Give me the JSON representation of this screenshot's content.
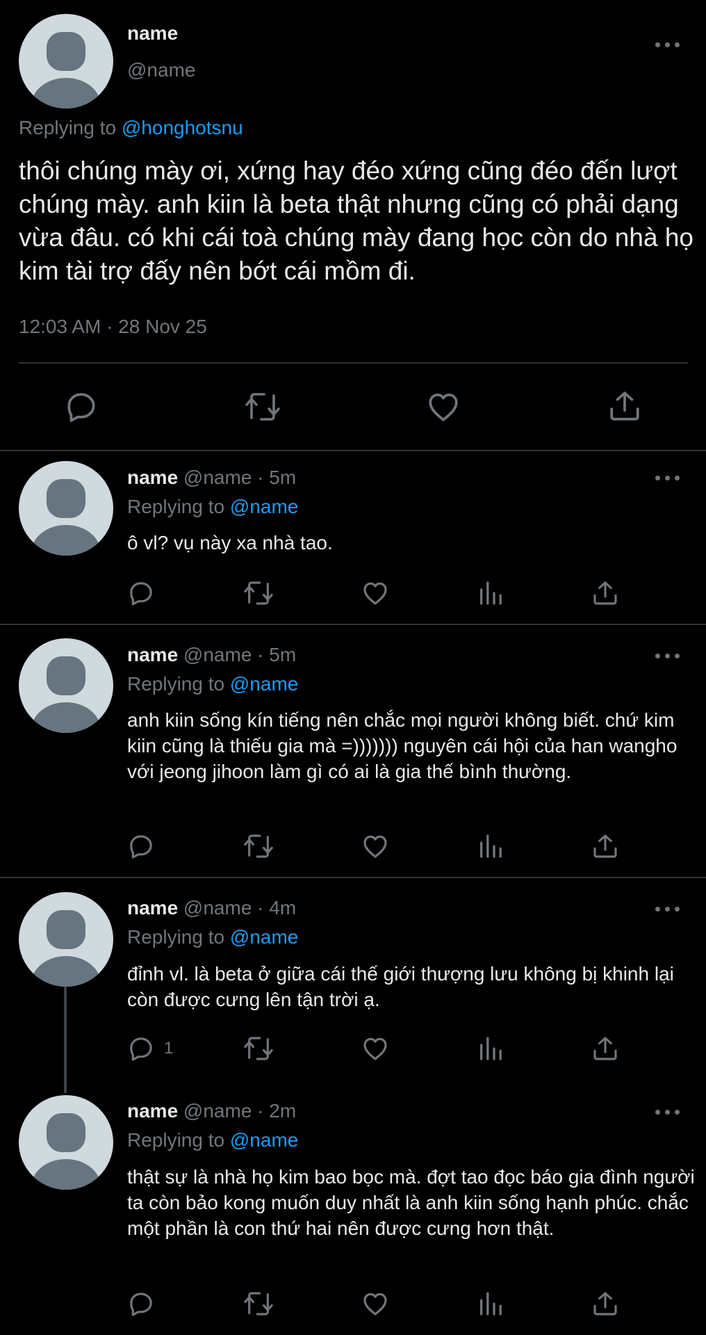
{
  "main_tweet": {
    "name": "name",
    "handle": "@name",
    "replying_prefix": "Replying to ",
    "replying_to": "@honghotsnu",
    "text": "thôi chúng mày ơi, xứng hay đéo xứng cũng đéo đến lượt chúng mày. anh kiin là beta thật nhưng cũng có phải dạng vừa đâu. có khi cái toà chúng mày đang học còn do nhà họ kim tài trợ đấy nên bớt cái mồm đi.",
    "timestamp": "12:03 AM · 28 Nov 25"
  },
  "replies": [
    {
      "name": "name",
      "meta": " @name · 5m",
      "replying_prefix": "Replying to ",
      "replying_to": "@name",
      "text": "ô vl? vụ này xa nhà tao.",
      "reply_count": ""
    },
    {
      "name": "name",
      "meta": " @name · 5m",
      "replying_prefix": "Replying to ",
      "replying_to": "@name",
      "text": "anh kiin sống kín tiếng nên chắc mọi người không biết. chứ kim kiin cũng là thiếu gia mà =))))))) nguyên cái hội của han wangho với jeong jihoon làm gì có ai là gia thế bình thường.",
      "reply_count": ""
    },
    {
      "name": "name",
      "meta": " @name · 4m",
      "replying_prefix": "Replying to ",
      "replying_to": "@name",
      "text": "đỉnh vl. là beta ở giữa cái thế giới thượng lưu không bị khinh lại còn được cưng lên tận trời ạ.",
      "reply_count": "1"
    },
    {
      "name": "name",
      "meta": " @name · 2m",
      "replying_prefix": "Replying to ",
      "replying_to": "@name",
      "text": "thật sự là nhà họ kim bao bọc mà. đợt tao đọc báo gia đình người ta còn bảo kong muốn duy nhất là anh kiin sống hạnh phúc. chắc một phần là con thứ hai nên được cưng hơn thật.",
      "reply_count": ""
    }
  ],
  "icons": {
    "reply": "reply-icon",
    "retweet": "retweet-icon",
    "like": "heart-icon",
    "views": "views-icon",
    "share": "share-icon",
    "more": "more-icon"
  },
  "colors": {
    "background": "#000000",
    "text": "#e7e9ea",
    "secondary": "#71767b",
    "accent": "#1d9bf0",
    "divider": "#2f3336"
  }
}
